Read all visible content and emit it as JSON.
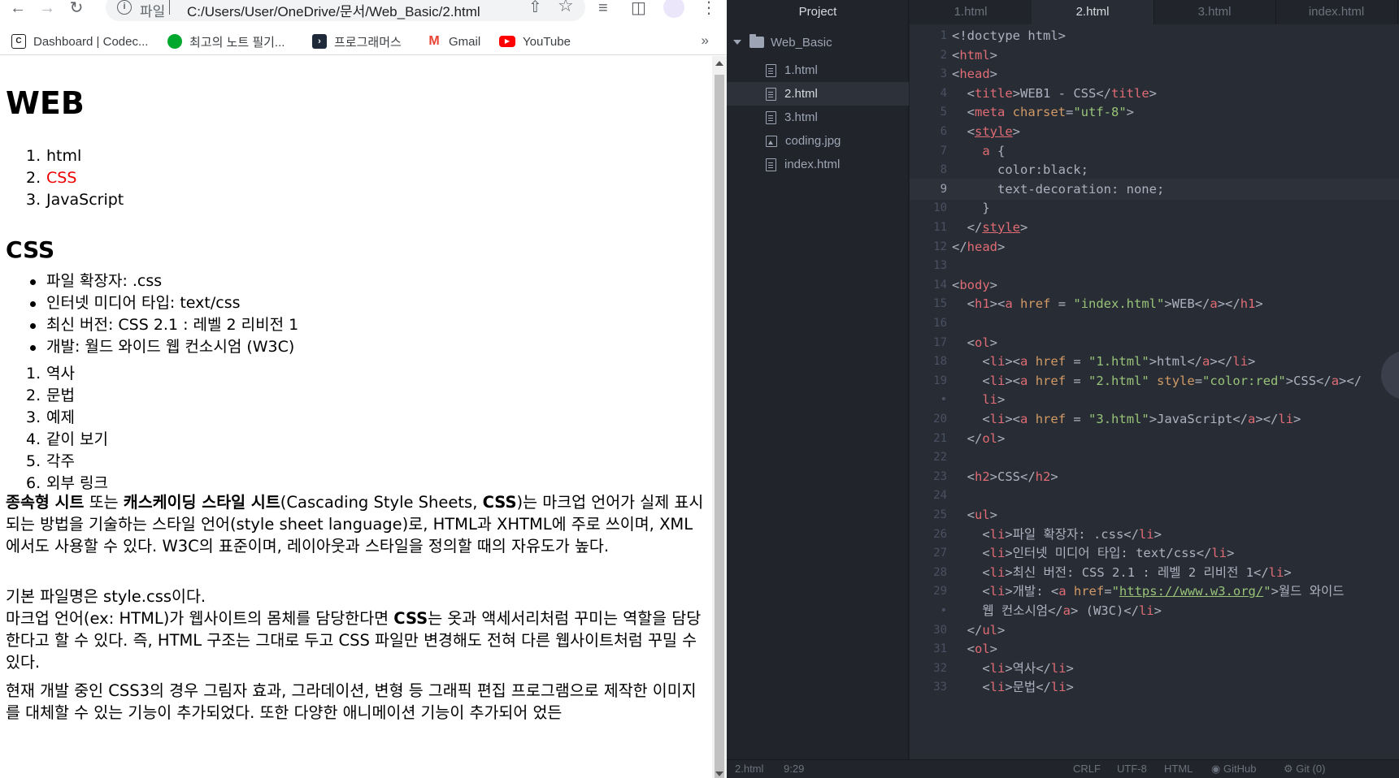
{
  "browser": {
    "omnibox": {
      "scheme_label": "파일",
      "url": "C:/Users/User/OneDrive/문서/Web_Basic/2.html"
    },
    "bookmarks": [
      {
        "label": "Dashboard | Codec...",
        "icon": "codecademy-icon",
        "color": "#1f1f1f"
      },
      {
        "label": "최고의 노트 필기...",
        "icon": "evernote-icon",
        "color": "#00a82d"
      },
      {
        "label": "프로그래머스",
        "icon": "programmers-icon",
        "color": "#1e2a3a"
      },
      {
        "label": "Gmail",
        "icon": "gmail-icon",
        "color": "#ea4335"
      },
      {
        "label": "YouTube",
        "icon": "youtube-icon",
        "color": "#ff0000"
      }
    ],
    "page": {
      "h1": "WEB",
      "nav_list": [
        "html",
        "CSS",
        "JavaScript"
      ],
      "nav_active_color": "#ff0000",
      "h2": "CSS",
      "facts": [
        "파일 확장자: .css",
        "인터넷 미디어 타입: text/css",
        "최신 버전: CSS 2.1 : 레벨 2 리비전 1",
        "개발: 월드 와이드 웹 컨소시엄 (W3C)"
      ],
      "toc": [
        "역사",
        "문법",
        "예제",
        "같이 보기",
        "각주",
        "외부 링크"
      ],
      "p1": {
        "b1": "종속형 시트",
        "t1": " 또는 ",
        "b2": "캐스케이딩 스타일 시트",
        "t2": "(Cascading Style Sheets, ",
        "b3": "CSS",
        "t3": ")는 마크업 언어가 실제 표시되는 방법을 기술하는 스타일 언어(style sheet language)로, HTML과 XHTML에 주로 쓰이며, XML에서도 사용할 수 있다. W3C의 표준이며, 레이아웃과 스타일을 정의할 때의 자유도가 높다."
      },
      "p2": {
        "line1": "기본 파일명은 style.css이다.",
        "t1": "마크업 언어(ex: HTML)가 웹사이트의 몸체를 담당한다면 ",
        "b1": "CSS",
        "t2": "는 옷과 액세서리처럼 꾸미는 역할을 담당한다고 할 수 있다. 즉, HTML 구조는 그대로 두고 CSS 파일만 변경해도 전혀 다른 웹사이트처럼 꾸밀 수 있다."
      },
      "p3": "현재 개발 중인 CSS3의 경우 그림자 효과, 그라데이션, 변형 등 그래픽 편집 프로그램으로 제작한 이미지를 대체할 수 있는 기능이 추가되었다. 또한 다양한 애니메이션 기능이 추가되어 었든"
    }
  },
  "editor": {
    "tree": {
      "header": "Project",
      "folder": "Web_Basic",
      "files": [
        {
          "name": "1.html",
          "type": "file"
        },
        {
          "name": "2.html",
          "type": "file",
          "active": true
        },
        {
          "name": "3.html",
          "type": "file"
        },
        {
          "name": "coding.jpg",
          "type": "image"
        },
        {
          "name": "index.html",
          "type": "file"
        }
      ]
    },
    "tabs": [
      "1.html",
      "2.html",
      "3.html",
      "index.html"
    ],
    "active_tab": "2.html",
    "current_line": "9",
    "code_lines": [
      {
        "n": "1",
        "parts": [
          [
            "pl",
            "<!doctype html>"
          ]
        ]
      },
      {
        "n": "2",
        "parts": [
          [
            "pl",
            "<"
          ],
          [
            "t",
            "html"
          ],
          [
            "pl",
            ">"
          ]
        ]
      },
      {
        "n": "3",
        "parts": [
          [
            "pl",
            "<"
          ],
          [
            "t",
            "head"
          ],
          [
            "pl",
            ">"
          ]
        ]
      },
      {
        "n": "4",
        "parts": [
          [
            "pl",
            "  <"
          ],
          [
            "t",
            "title"
          ],
          [
            "pl",
            ">WEB1 - CSS</"
          ],
          [
            "t",
            "title"
          ],
          [
            "pl",
            ">"
          ]
        ]
      },
      {
        "n": "5",
        "parts": [
          [
            "pl",
            "  <"
          ],
          [
            "t",
            "meta"
          ],
          [
            "pl",
            " "
          ],
          [
            "at",
            "charset"
          ],
          [
            "pl",
            "="
          ],
          [
            "st",
            "\"utf-8\""
          ],
          [
            "pl",
            ">"
          ]
        ]
      },
      {
        "n": "6",
        "parts": [
          [
            "pl",
            "  <"
          ],
          [
            "t un",
            "style"
          ],
          [
            "pl",
            ">"
          ]
        ]
      },
      {
        "n": "7",
        "parts": [
          [
            "pl",
            "    "
          ],
          [
            "t",
            "a"
          ],
          [
            "pl",
            " {"
          ]
        ]
      },
      {
        "n": "8",
        "parts": [
          [
            "pl",
            "      color:black;"
          ]
        ]
      },
      {
        "n": "9",
        "parts": [
          [
            "pl",
            "      text-decoration: none;"
          ]
        ]
      },
      {
        "n": "10",
        "parts": [
          [
            "pl",
            "    }"
          ]
        ]
      },
      {
        "n": "11",
        "parts": [
          [
            "pl",
            "  </"
          ],
          [
            "t un",
            "style"
          ],
          [
            "pl",
            ">"
          ]
        ]
      },
      {
        "n": "12",
        "parts": [
          [
            "pl",
            "</"
          ],
          [
            "t",
            "head"
          ],
          [
            "pl",
            ">"
          ]
        ]
      },
      {
        "n": "13",
        "parts": [
          [
            "pl",
            ""
          ]
        ]
      },
      {
        "n": "14",
        "parts": [
          [
            "pl",
            "<"
          ],
          [
            "t",
            "body"
          ],
          [
            "pl",
            ">"
          ]
        ]
      },
      {
        "n": "15",
        "parts": [
          [
            "pl",
            "  <"
          ],
          [
            "t",
            "h1"
          ],
          [
            "pl",
            "><"
          ],
          [
            "t",
            "a"
          ],
          [
            "pl",
            " "
          ],
          [
            "at",
            "href"
          ],
          [
            "pl",
            " = "
          ],
          [
            "st",
            "\"index.html\""
          ],
          [
            "pl",
            ">WEB</"
          ],
          [
            "t",
            "a"
          ],
          [
            "pl",
            "></"
          ],
          [
            "t",
            "h1"
          ],
          [
            "pl",
            ">"
          ]
        ]
      },
      {
        "n": "16",
        "parts": [
          [
            "pl",
            ""
          ]
        ]
      },
      {
        "n": "17",
        "parts": [
          [
            "pl",
            "  <"
          ],
          [
            "t",
            "ol"
          ],
          [
            "pl",
            ">"
          ]
        ]
      },
      {
        "n": "18",
        "parts": [
          [
            "pl",
            "    <"
          ],
          [
            "t",
            "li"
          ],
          [
            "pl",
            "><"
          ],
          [
            "t",
            "a"
          ],
          [
            "pl",
            " "
          ],
          [
            "at",
            "href"
          ],
          [
            "pl",
            " = "
          ],
          [
            "st",
            "\"1.html\""
          ],
          [
            "pl",
            ">html</"
          ],
          [
            "t",
            "a"
          ],
          [
            "pl",
            "></"
          ],
          [
            "t",
            "li"
          ],
          [
            "pl",
            ">"
          ]
        ]
      },
      {
        "n": "19",
        "parts": [
          [
            "pl",
            "    <"
          ],
          [
            "t",
            "li"
          ],
          [
            "pl",
            "><"
          ],
          [
            "t",
            "a"
          ],
          [
            "pl",
            " "
          ],
          [
            "at",
            "href"
          ],
          [
            "pl",
            " = "
          ],
          [
            "st",
            "\"2.html\""
          ],
          [
            "pl",
            " "
          ],
          [
            "at",
            "style"
          ],
          [
            "pl",
            "="
          ],
          [
            "st",
            "\"color:red\""
          ],
          [
            "pl",
            ">CSS</"
          ],
          [
            "t",
            "a"
          ],
          [
            "pl",
            "></"
          ]
        ]
      },
      {
        "n": "•",
        "parts": [
          [
            "pl",
            "    "
          ],
          [
            "t",
            "li"
          ],
          [
            "pl",
            ">"
          ]
        ]
      },
      {
        "n": "20",
        "parts": [
          [
            "pl",
            "    <"
          ],
          [
            "t",
            "li"
          ],
          [
            "pl",
            "><"
          ],
          [
            "t",
            "a"
          ],
          [
            "pl",
            " "
          ],
          [
            "at",
            "href"
          ],
          [
            "pl",
            " = "
          ],
          [
            "st",
            "\"3.html\""
          ],
          [
            "pl",
            ">JavaScript</"
          ],
          [
            "t",
            "a"
          ],
          [
            "pl",
            "></"
          ],
          [
            "t",
            "li"
          ],
          [
            "pl",
            ">"
          ]
        ]
      },
      {
        "n": "21",
        "parts": [
          [
            "pl",
            "  </"
          ],
          [
            "t",
            "ol"
          ],
          [
            "pl",
            ">"
          ]
        ]
      },
      {
        "n": "22",
        "parts": [
          [
            "pl",
            ""
          ]
        ]
      },
      {
        "n": "23",
        "parts": [
          [
            "pl",
            "  <"
          ],
          [
            "t",
            "h2"
          ],
          [
            "pl",
            ">CSS</"
          ],
          [
            "t",
            "h2"
          ],
          [
            "pl",
            ">"
          ]
        ]
      },
      {
        "n": "24",
        "parts": [
          [
            "pl",
            ""
          ]
        ]
      },
      {
        "n": "25",
        "parts": [
          [
            "pl",
            "  <"
          ],
          [
            "t",
            "ul"
          ],
          [
            "pl",
            ">"
          ]
        ]
      },
      {
        "n": "26",
        "parts": [
          [
            "pl",
            "    <"
          ],
          [
            "t",
            "li"
          ],
          [
            "pl",
            ">파일 확장자: .css</"
          ],
          [
            "t",
            "li"
          ],
          [
            "pl",
            ">"
          ]
        ]
      },
      {
        "n": "27",
        "parts": [
          [
            "pl",
            "    <"
          ],
          [
            "t",
            "li"
          ],
          [
            "pl",
            ">인터넷 미디어 타입: text/css</"
          ],
          [
            "t",
            "li"
          ],
          [
            "pl",
            ">"
          ]
        ]
      },
      {
        "n": "28",
        "parts": [
          [
            "pl",
            "    <"
          ],
          [
            "t",
            "li"
          ],
          [
            "pl",
            ">최신 버전: CSS 2.1 : 레벨 2 리비전 1</"
          ],
          [
            "t",
            "li"
          ],
          [
            "pl",
            ">"
          ]
        ]
      },
      {
        "n": "29",
        "parts": [
          [
            "pl",
            "    <"
          ],
          [
            "t",
            "li"
          ],
          [
            "pl",
            ">개발: <"
          ],
          [
            "t",
            "a"
          ],
          [
            "pl",
            " "
          ],
          [
            "at",
            "href"
          ],
          [
            "pl",
            "="
          ],
          [
            "st",
            "\""
          ],
          [
            "st un",
            "https://www.w3.org/"
          ],
          [
            "st",
            "\""
          ],
          [
            "pl",
            ">월드 와이드"
          ]
        ]
      },
      {
        "n": "•",
        "parts": [
          [
            "pl",
            "    웹 컨소시엄</"
          ],
          [
            "t",
            "a"
          ],
          [
            "pl",
            "> (W3C)</"
          ],
          [
            "t",
            "li"
          ],
          [
            "pl",
            ">"
          ]
        ]
      },
      {
        "n": "30",
        "parts": [
          [
            "pl",
            "  </"
          ],
          [
            "t",
            "ul"
          ],
          [
            "pl",
            ">"
          ]
        ]
      },
      {
        "n": "31",
        "parts": [
          [
            "pl",
            "  <"
          ],
          [
            "t",
            "ol"
          ],
          [
            "pl",
            ">"
          ]
        ]
      },
      {
        "n": "32",
        "parts": [
          [
            "pl",
            "    <"
          ],
          [
            "t",
            "li"
          ],
          [
            "pl",
            ">역사</"
          ],
          [
            "t",
            "li"
          ],
          [
            "pl",
            ">"
          ]
        ]
      },
      {
        "n": "33",
        "parts": [
          [
            "pl",
            "    <"
          ],
          [
            "t",
            "li"
          ],
          [
            "pl",
            ">문법</"
          ],
          [
            "t",
            "li"
          ],
          [
            "pl",
            ">"
          ]
        ]
      }
    ],
    "status": {
      "file": "2.html",
      "cursor": "9:29",
      "line_ending": "CRLF",
      "encoding": "UTF-8",
      "grammar": "HTML",
      "github": "GitHub",
      "git": "Git (0)"
    }
  }
}
